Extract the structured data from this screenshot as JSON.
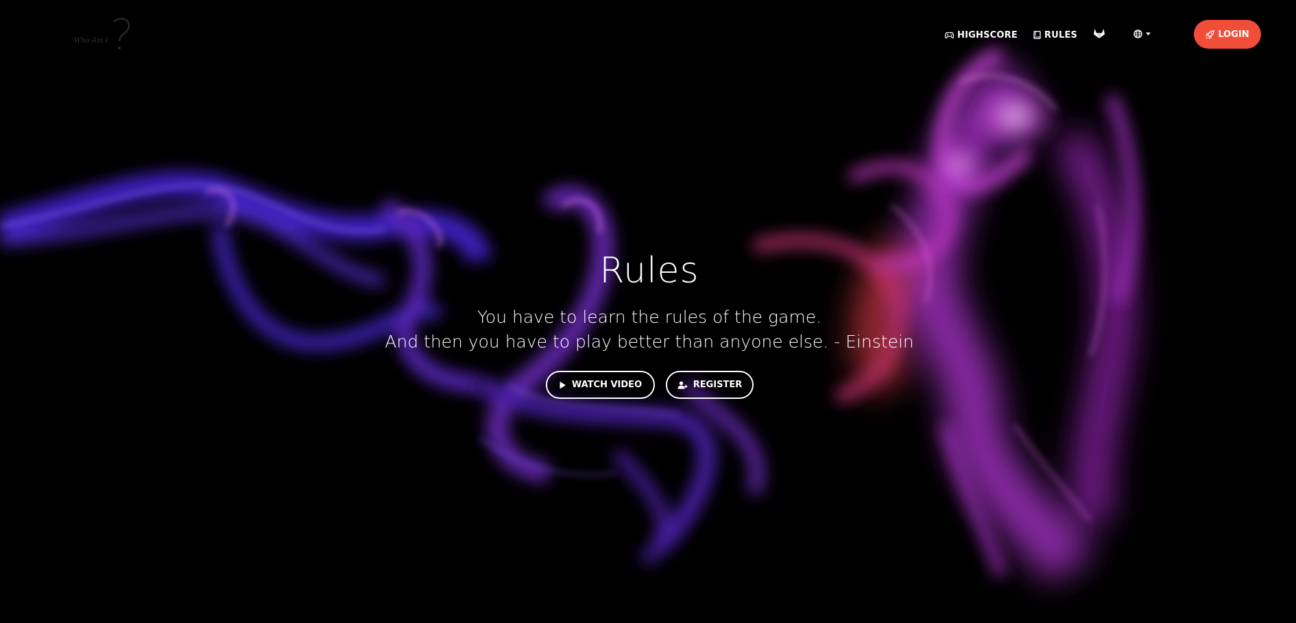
{
  "navbar": {
    "logo_alt": "Who Am I ?",
    "links": [
      {
        "label": "HIGHSCORE",
        "icon": "gamepad-icon"
      },
      {
        "label": "RULES",
        "icon": "book-icon"
      }
    ],
    "gitlab_icon": "gitlab-icon",
    "language_icon": "globe-icon",
    "login": {
      "label": "LOGIN",
      "icon": "rocket-icon"
    }
  },
  "hero": {
    "title": "Rules",
    "subtitle_line1": "You have to learn the rules of the game.",
    "subtitle_line2": "And then you have to play better than anyone else. - Einstein",
    "buttons": [
      {
        "label": "WATCH VIDEO",
        "icon": "play-icon"
      },
      {
        "label": "REGISTER",
        "icon": "user-plus-icon"
      }
    ]
  },
  "colors": {
    "background": "#000000",
    "accent": "#f14e3a",
    "text": "#ffffff",
    "smoke_purple": "#b43cc8",
    "smoke_blue": "#5a2ee0",
    "smoke_red": "#c8324a"
  }
}
